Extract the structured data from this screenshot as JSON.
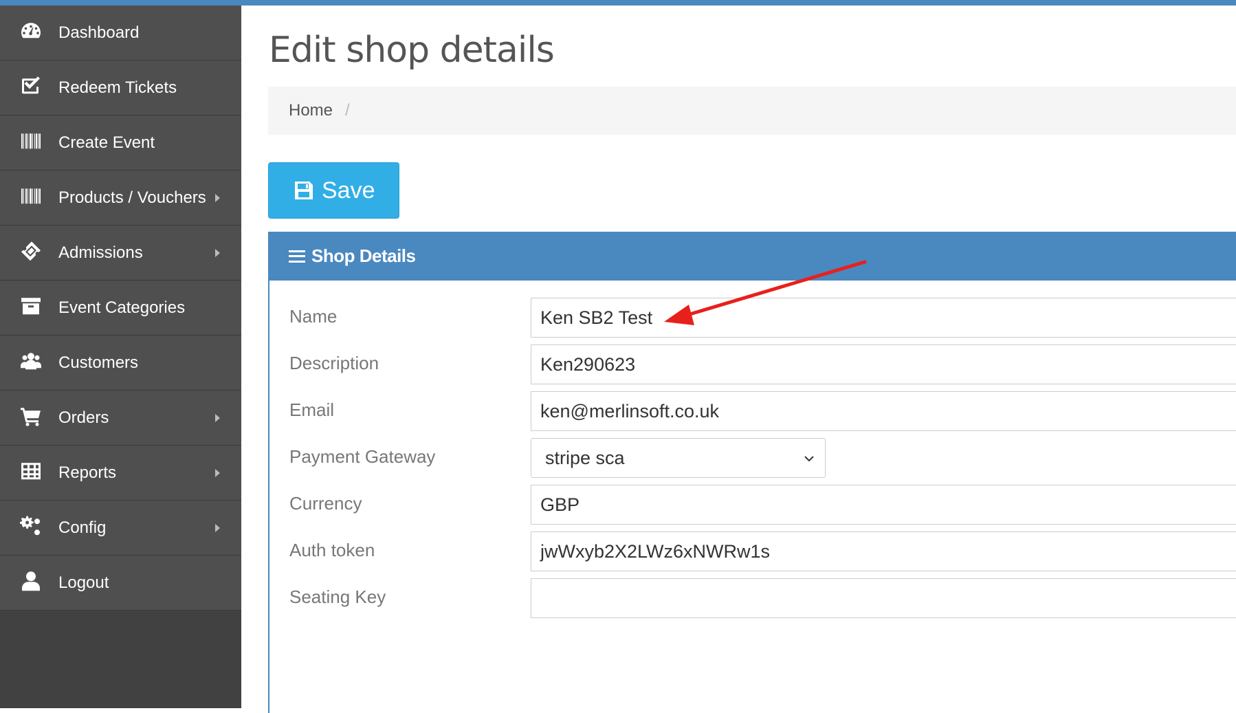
{
  "sidebar": {
    "items": [
      {
        "label": "Dashboard",
        "icon": "dashboard-icon",
        "has_submenu": false
      },
      {
        "label": "Redeem Tickets",
        "icon": "checkbox-icon",
        "has_submenu": false
      },
      {
        "label": "Create Event",
        "icon": "barcode-icon",
        "has_submenu": false
      },
      {
        "label": "Products / Vouchers",
        "icon": "barcode-icon",
        "has_submenu": true
      },
      {
        "label": "Admissions",
        "icon": "ticket-icon",
        "has_submenu": true
      },
      {
        "label": "Event Categories",
        "icon": "archive-icon",
        "has_submenu": false
      },
      {
        "label": "Customers",
        "icon": "users-icon",
        "has_submenu": false
      },
      {
        "label": "Orders",
        "icon": "cart-icon",
        "has_submenu": true
      },
      {
        "label": "Reports",
        "icon": "table-icon",
        "has_submenu": true
      },
      {
        "label": "Config",
        "icon": "cogs-icon",
        "has_submenu": true
      },
      {
        "label": "Logout",
        "icon": "user-icon",
        "has_submenu": false
      }
    ]
  },
  "page": {
    "title": "Edit shop details",
    "breadcrumb": {
      "home": "Home",
      "separator": "/"
    },
    "save_label": "Save"
  },
  "panel": {
    "title": "Shop Details",
    "fields": {
      "name": {
        "label": "Name",
        "value": "Ken SB2 Test"
      },
      "description": {
        "label": "Description",
        "value": "Ken290623"
      },
      "email": {
        "label": "Email",
        "value": "ken@merlinsoft.co.uk"
      },
      "payment_gateway": {
        "label": "Payment Gateway",
        "value": "stripe sca"
      },
      "currency": {
        "label": "Currency",
        "value": "GBP"
      },
      "auth_token": {
        "label": "Auth token",
        "value": "jwWxyb2X2LWz6xNWRw1s"
      },
      "seating_key": {
        "label": "Seating Key",
        "value": ""
      }
    }
  },
  "colors": {
    "accent": "#4a88c0",
    "save_button": "#32aee6",
    "sidebar_item": "#4f4f4f",
    "sidebar_bg": "#414141",
    "annotation_arrow": "#e8201c"
  }
}
